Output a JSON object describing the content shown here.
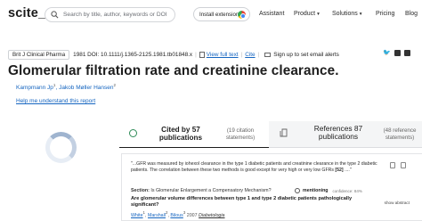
{
  "nav": {
    "logo": "scite_",
    "search_placeholder": "Search by title, author, keywords or DOI",
    "install_label": "Install extension!",
    "links": [
      "Assistant",
      "Product",
      "Solutions",
      "Pricing",
      "Blog"
    ]
  },
  "article": {
    "journal": "Brit J Clinical Pharma",
    "year_doi": "1981 DOI: 10.1111/j.1365-2125.1981.tb01848.x",
    "view_full_text": "View full text",
    "cite": "Cite",
    "signup": "Sign up to set email alerts",
    "title": "Glomerular filtration rate and creatinine clearance.",
    "author1": "Kampmann Jp",
    "author1_sup": "1",
    "author2": "Jakob Møller Hansen",
    "author2_sup": "2",
    "help_link": "Help me understand this report"
  },
  "tabs": {
    "cited_main": "Cited by 57 publications",
    "cited_sub": "(19 citation statements)",
    "refs_main": "References 87 publications",
    "refs_sub": "(48 reference statements)"
  },
  "citation": {
    "snippet_a": "\"...GFR was measured by iohexol clearance in the type 1 diabetic patients and creatinine clearance in the type 2 diabetic patients. The correlation between these two methods is good except for very high or very low GFRs ",
    "snippet_ref": "[52]",
    "snippet_b": " ....\"",
    "section_label": "Section:",
    "section_text": "Is Glomerular Enlargement a Compensatory Mechanism?",
    "mentioning": "mentioning",
    "confidence": "confidence: 84%",
    "show_abstract": "show abstract",
    "ref_title": "Are glomerular volume differences between type 1 and type 2 diabetic patients pathologically significant?",
    "ref_author1": "White",
    "ref_author2": "Marshall",
    "ref_author3": "Bilous",
    "ref_year": "2007",
    "ref_journal": "Diabetologia"
  }
}
